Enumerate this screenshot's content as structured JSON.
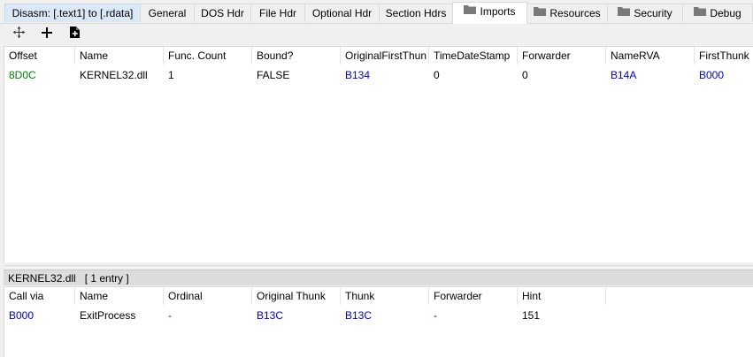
{
  "tabs": [
    {
      "label": "Disasm: [.text1] to [.rdata]"
    },
    {
      "label": "General"
    },
    {
      "label": "DOS Hdr"
    },
    {
      "label": "File Hdr"
    },
    {
      "label": "Optional Hdr"
    },
    {
      "label": "Section Hdrs"
    },
    {
      "label": "Imports",
      "active": true,
      "icon": "folder-icon"
    },
    {
      "label": "Resources",
      "icon": "folder-icon"
    },
    {
      "label": "Security",
      "icon": "folder-icon"
    },
    {
      "label": "Debug",
      "icon": "folder-icon"
    }
  ],
  "toolbar": {
    "icons": [
      "move-icon",
      "plus-icon",
      "add-document-icon"
    ]
  },
  "imports_table": {
    "headers": [
      "Offset",
      "Name",
      "Func. Count",
      "Bound?",
      "OriginalFirstThun",
      "TimeDateStamp",
      "Forwarder",
      "NameRVA",
      "FirstThunk"
    ],
    "rows": [
      [
        "8D0C",
        "KERNEL32.dll",
        "1",
        "FALSE",
        "B134",
        "0",
        "0",
        "B14A",
        "B000"
      ]
    ]
  },
  "section_bar": {
    "label": "KERNEL32.dll   [ 1 entry ]"
  },
  "functions_table": {
    "headers": [
      "Call via",
      "Name",
      "Ordinal",
      "Original Thunk",
      "Thunk",
      "Forwarder",
      "Hint"
    ],
    "rows": [
      [
        "B000",
        "ExitProcess",
        "-",
        "B13C",
        "B13C",
        "-",
        "151"
      ]
    ]
  },
  "colors": {
    "link_blue": "#0000cc",
    "offset_green": "#008000",
    "first_tab_bg": "#dbe8f6"
  }
}
